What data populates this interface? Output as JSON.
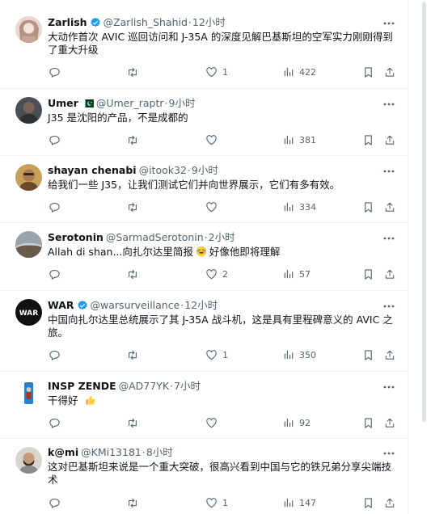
{
  "tweets": [
    {
      "name": "Zarlish",
      "verified": true,
      "handle": "@Zarlish_Shahid",
      "dot": "·",
      "time": "12小时",
      "text": "大动作首次 AVIC 巡回访问和 J-35A 的深度见解巴基斯坦的空军实力刚刚得到了重大升级",
      "likes": "1",
      "views": "422"
    },
    {
      "name": "Umer",
      "flag": "pakistan-flag-icon",
      "handle": "@Umer_raptr",
      "dot": "·",
      "time": "9小时",
      "text": "J35 是沈阳的产品，不是成都的",
      "likes": "",
      "views": "381"
    },
    {
      "name": "shayan chenabi",
      "handle": "@itook32",
      "dot": "·",
      "time": "9小时",
      "text": "给我们一些 J35，让我们测试它们并向世界展示，它们有多有效。",
      "likes": "",
      "views": "334"
    },
    {
      "name": "Serotonin",
      "handle": "@SarmadSerotonin",
      "dot": "·",
      "time": "2小时",
      "text_before": "Allah di shan...向扎尔达里简报",
      "emoji": "laughing-emoji-icon",
      "text_after": "好像他即将理解",
      "likes": "2",
      "views": "57"
    },
    {
      "name": "WAR",
      "verified": true,
      "handle": "@warsurveillance",
      "dot": "·",
      "time": "12小时",
      "text": "中国向扎尔达里总统展示了其 J-35A 战斗机，这是具有里程碑意义的 AVIC 之旅。",
      "likes": "1",
      "views": "350"
    },
    {
      "name": "INSP ZENDE",
      "handle": "@AD77YK",
      "dot": "·",
      "time": "7小时",
      "text": "干得好",
      "emoji": "thumbs-up-icon",
      "likes": "",
      "views": "92"
    },
    {
      "name": "k@mi",
      "handle": "@KMi13181",
      "dot": "·",
      "time": "8小时",
      "text": "这对巴基斯坦来说是一个重大突破，很高兴看到中国与它的铁兄弟分享尖端技术",
      "likes": "1",
      "views": "147"
    }
  ],
  "colors": {
    "text": "#0f1419",
    "secondary": "#536471",
    "verified": "#1d9bf0",
    "border": "#eff3f4"
  }
}
